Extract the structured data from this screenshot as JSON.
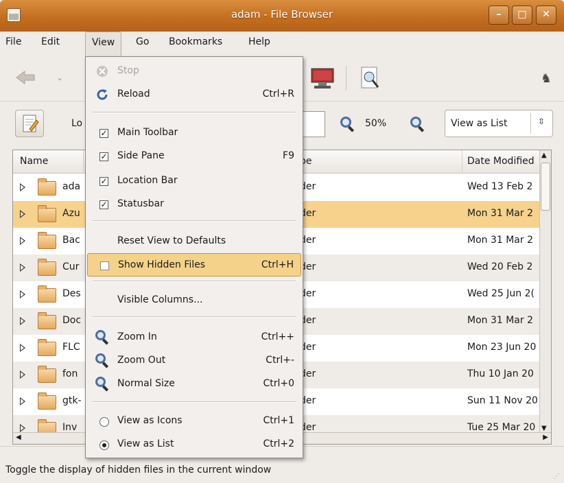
{
  "window": {
    "title": "adam - File Browser"
  },
  "menubar": {
    "items": [
      "File",
      "Edit",
      "View",
      "Go",
      "Bookmarks",
      "Help"
    ]
  },
  "zoom": {
    "value": "50%"
  },
  "view_select": {
    "value": "View as List"
  },
  "location": {
    "label": "Lo"
  },
  "columns": {
    "name": "Name",
    "type": "pe",
    "date": "Date Modified"
  },
  "rows": [
    {
      "name": "ada",
      "type": "der",
      "date": "Wed 13 Feb 2"
    },
    {
      "name": "Azu",
      "type": "der",
      "date": "Mon 31 Mar 2"
    },
    {
      "name": "Bac",
      "type": "der",
      "date": "Mon 31 Mar 2"
    },
    {
      "name": "Cur",
      "type": "der",
      "date": "Wed 20 Feb 2"
    },
    {
      "name": "Des",
      "type": "der",
      "date": "Wed 25 Jun 2("
    },
    {
      "name": "Doc",
      "type": "der",
      "date": "Mon 31 Mar 2"
    },
    {
      "name": "FLC",
      "type": "der",
      "date": "Mon 23 Jun 20"
    },
    {
      "name": "fon",
      "type": "der",
      "date": "Thu 10 Jan 20"
    },
    {
      "name": "gtk-",
      "type": "der",
      "date": "Sun 11 Nov 20"
    },
    {
      "name": "Inv",
      "type": "der",
      "date": "Tue 25 Mar 20"
    }
  ],
  "view_menu": {
    "stop": "Stop",
    "reload": "Reload",
    "reload_acc": "Ctrl+R",
    "main_toolbar": "Main Toolbar",
    "side_pane": "Side Pane",
    "side_pane_acc": "F9",
    "location_bar": "Location Bar",
    "statusbar": "Statusbar",
    "reset_view": "Reset View to Defaults",
    "show_hidden": "Show Hidden Files",
    "show_hidden_acc": "Ctrl+H",
    "visible_columns": "Visible Columns...",
    "zoom_in": "Zoom In",
    "zoom_in_acc": "Ctrl++",
    "zoom_out": "Zoom Out",
    "zoom_out_acc": "Ctrl+-",
    "normal_size": "Normal Size",
    "normal_size_acc": "Ctrl+0",
    "view_icons": "View as Icons",
    "view_icons_acc": "Ctrl+1",
    "view_list": "View as List",
    "view_list_acc": "Ctrl+2"
  },
  "status": {
    "text": "Toggle the display of hidden files in the current window"
  },
  "colors": {
    "title_bar": "#c46e1f",
    "highlight": "#f5d28a",
    "selected_row": "#f6d28d"
  }
}
